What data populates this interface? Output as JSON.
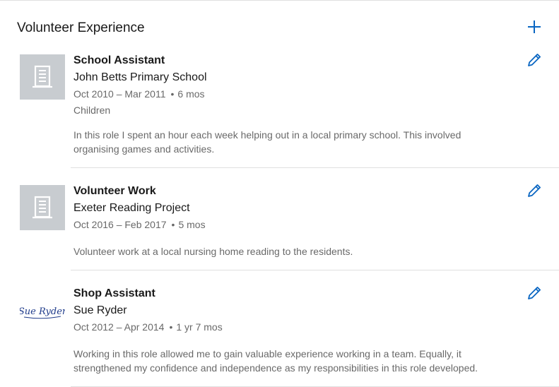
{
  "section": {
    "title": "Volunteer Experience",
    "add_icon": "plus-icon",
    "accent_color": "#0a66c2"
  },
  "entries": [
    {
      "role": "School Assistant",
      "organization": "John Betts Primary School",
      "date_range": "Oct 2010 – Mar 2011",
      "duration": "6 mos",
      "cause": "Children",
      "description": "In this role I spent an hour each week helping out in a local primary school. This involved organising games and activities.",
      "logo": "building-icon"
    },
    {
      "role": "Volunteer Work",
      "organization": "Exeter Reading Project",
      "date_range": "Oct 2016 – Feb 2017",
      "duration": "5 mos",
      "description": "Volunteer work at a local nursing home reading to the residents.",
      "logo": "building-icon"
    },
    {
      "role": "Shop Assistant",
      "organization": "Sue Ryder",
      "date_range": "Oct 2012 – Apr 2014",
      "duration": "1 yr 7 mos",
      "description": "Working in this role allowed me to gain valuable experience working in a team. Equally, it strengthened my confidence and independence as my responsibilities in this role developed.",
      "logo": "sue-ryder-logo",
      "logo_text": "Sue Ryder"
    }
  ]
}
